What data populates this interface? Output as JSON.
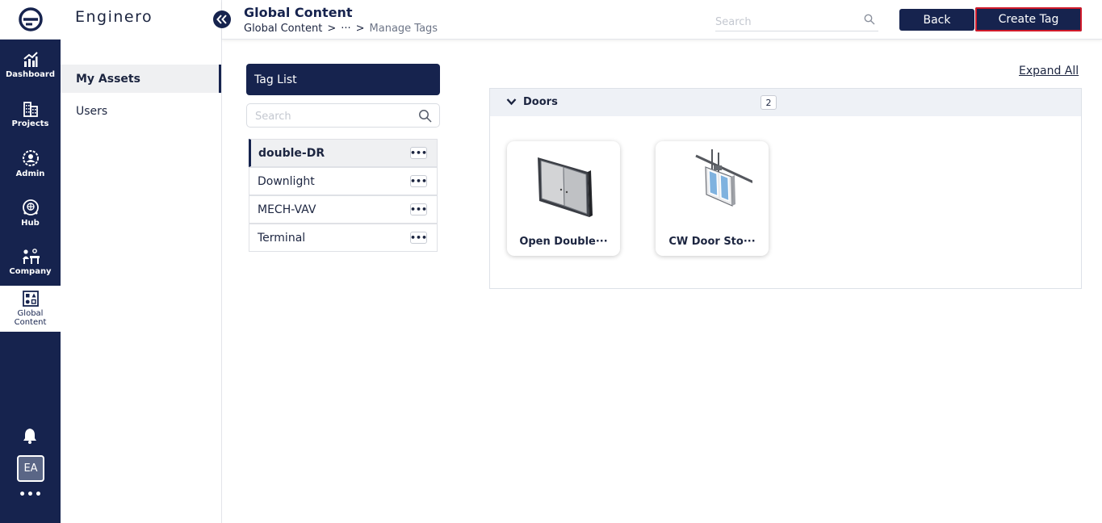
{
  "app": {
    "brand": "Enginero",
    "logo_letter": "e"
  },
  "rail": {
    "items": [
      {
        "label": "Dashboard",
        "icon": "chart-up-icon"
      },
      {
        "label": "Projects",
        "icon": "building-icon"
      },
      {
        "label": "Admin",
        "icon": "user-gear-icon"
      },
      {
        "label": "Hub",
        "icon": "globe-person-icon"
      },
      {
        "label": "Company",
        "icon": "people-desk-icon"
      },
      {
        "label_line1": "Global",
        "label_line2": "Content",
        "icon": "shapes-grid-icon",
        "active": true
      }
    ],
    "avatar_initials": "EA",
    "more": "•••"
  },
  "sidebar": {
    "items": [
      {
        "label": "My Assets",
        "active": true
      },
      {
        "label": "Users"
      }
    ]
  },
  "header": {
    "title": "Global Content",
    "breadcrumb": {
      "root": "Global Content",
      "sep1": ">",
      "ellipsis": "···",
      "sep2": ">",
      "current": "Manage Tags"
    },
    "search_placeholder": "Search",
    "back_label": "Back",
    "create_label": "Create Tag"
  },
  "tag_list": {
    "title": "Tag List",
    "search_placeholder": "Search",
    "tags": [
      {
        "name": "double-DR",
        "selected": true
      },
      {
        "name": "Downlight"
      },
      {
        "name": "MECH-VAV"
      },
      {
        "name": "Terminal"
      }
    ],
    "menu_glyph": "•••"
  },
  "content": {
    "expand_all": "Expand All",
    "group": {
      "name": "Doors",
      "count": "2",
      "items": [
        {
          "name": "Open Double···",
          "thumb": "double-door-thumbnail"
        },
        {
          "name": "CW Door Sto···",
          "thumb": "sliding-door-thumbnail"
        }
      ]
    }
  },
  "colors": {
    "navy": "#16234e",
    "accent_red": "#d11a2a",
    "selected_bg": "#eff0f2",
    "group_bg": "#eef1f6"
  }
}
